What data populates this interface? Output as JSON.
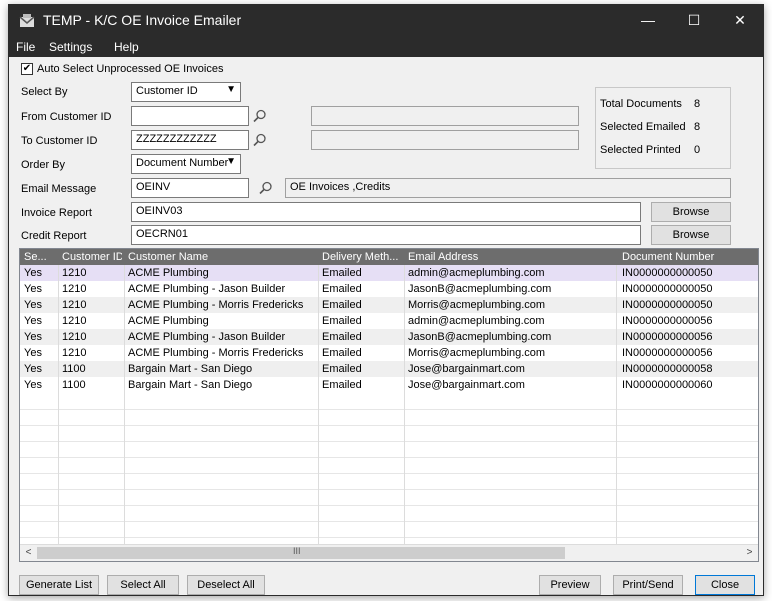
{
  "window": {
    "title": "TEMP - K/C OE Invoice Emailer",
    "minimize": "—",
    "maximize": "☐",
    "close": "✕"
  },
  "menu": [
    "File",
    "Settings",
    "Help"
  ],
  "form": {
    "auto_select_label": "Auto Select Unprocessed OE Invoices",
    "auto_select_checked": "✔",
    "select_by_label": "Select By",
    "select_by_value": "Customer ID",
    "from_customer_label": "From Customer ID",
    "from_customer_value": "",
    "from_customer_desc": "",
    "to_customer_label": "To Customer ID",
    "to_customer_value": "ZZZZZZZZZZZZ",
    "to_customer_desc": "",
    "order_by_label": "Order By",
    "order_by_value": "Document Number",
    "email_message_label": "Email Message",
    "email_message_value": "OEINV",
    "email_message_desc": "OE Invoices ,Credits",
    "invoice_report_label": "Invoice Report",
    "invoice_report_value": "OEINV03",
    "credit_report_label": "Credit Report",
    "credit_report_value": "OECRN01",
    "browse_label": "Browse"
  },
  "totals": {
    "total_documents_label": "Total Documents",
    "total_documents_value": "8",
    "selected_emailed_label": "Selected Emailed",
    "selected_emailed_value": "8",
    "selected_printed_label": "Selected Printed",
    "selected_printed_value": "0"
  },
  "grid": {
    "columns": [
      "Se...",
      "Customer ID",
      "Customer Name",
      "Delivery Meth...",
      "Email Address",
      "Document Number"
    ],
    "rows": [
      [
        "Yes",
        "1210",
        "ACME Plumbing",
        "Emailed",
        "admin@acmeplumbing.com",
        "IN0000000000050"
      ],
      [
        "Yes",
        "1210",
        "ACME Plumbing - Jason Builder",
        "Emailed",
        "JasonB@acmeplumbing.com",
        "IN0000000000050"
      ],
      [
        "Yes",
        "1210",
        "ACME Plumbing - Morris Fredericks",
        "Emailed",
        "Morris@acmeplumbing.com",
        "IN0000000000050"
      ],
      [
        "Yes",
        "1210",
        "ACME Plumbing",
        "Emailed",
        "admin@acmeplumbing.com",
        "IN0000000000056"
      ],
      [
        "Yes",
        "1210",
        "ACME Plumbing - Jason Builder",
        "Emailed",
        "JasonB@acmeplumbing.com",
        "IN0000000000056"
      ],
      [
        "Yes",
        "1210",
        "ACME Plumbing - Morris Fredericks",
        "Emailed",
        "Morris@acmeplumbing.com",
        "IN0000000000056"
      ],
      [
        "Yes",
        "1100",
        "Bargain Mart - San Diego",
        "Emailed",
        "Jose@bargainmart.com",
        "IN0000000000058"
      ],
      [
        "Yes",
        "1100",
        "Bargain Mart - San Diego",
        "Emailed",
        "Jose@bargainmart.com",
        "IN0000000000060"
      ]
    ],
    "scroll_thumb_glyph": "III",
    "scroll_left": "<",
    "scroll_right": ">"
  },
  "buttons": {
    "generate_list": "Generate List",
    "select_all": "Select All",
    "deselect_all": "Deselect All",
    "preview": "Preview",
    "print_send": "Print/Send",
    "close": "Close"
  },
  "colors": {
    "titlebar": "#2b2b2b",
    "selected_row": "#e6dff5",
    "grid_header": "#6d6d6d"
  }
}
